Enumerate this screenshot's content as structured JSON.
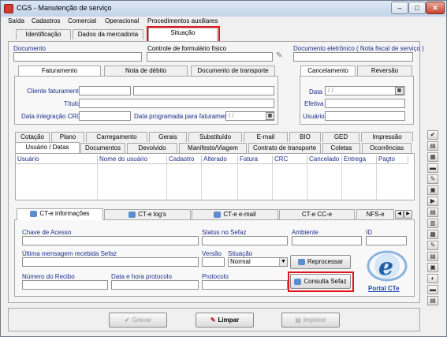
{
  "window": {
    "title": "CGS - Manutenção de serviço"
  },
  "menu": [
    "Saída",
    "Cadastros",
    "Comercial",
    "Operacional",
    "Procedimentos auxiliares"
  ],
  "top_tabs": [
    "Identificação",
    "Dados da mercadoria",
    "Situação"
  ],
  "documents": {
    "documento_label": "Documento",
    "controle_label": "Controle de formulário físico",
    "doc_eletronico_label": "Documento eletrônico ( Nota fiscal de serviço )"
  },
  "faturamento_tabs": [
    "Faturamento",
    "Nota de débito",
    "Documento de transporte"
  ],
  "faturamento": {
    "cliente_label": "Cliente faturamento",
    "titulo_label": "Título",
    "data_integracao_label": "Data integração CRC",
    "data_programada_label": "Data programada para faturamento",
    "data_programada_value": "/ /"
  },
  "cancel_tabs": [
    "Cancelamento",
    "Reversão"
  ],
  "cancelamento": {
    "data_label": "Data",
    "data_value": "/ /",
    "efetiva_label": "Efetiva",
    "usuario_label": "Usuário"
  },
  "tabs_row1": [
    "Cotação",
    "Plano",
    "Carregamento",
    "Gerais",
    "Substituído",
    "E-mail",
    "BIO",
    "GED",
    "Impressão"
  ],
  "tabs_row2": [
    "Usuário / Datas",
    "Documentos",
    "Devolvido",
    "Manifesto/Viagem",
    "Contrato de transporte",
    "Coletas",
    "Ocorrências"
  ],
  "grid_columns": [
    "Usuário",
    "Nome do usuário",
    "Cadastro",
    "Alterado",
    "Fatura",
    "CRC",
    "Cancelado",
    "Entrega",
    "Pagto"
  ],
  "cte_tabs": [
    "CT-e informações",
    "CT-e log's",
    "CT-e e-mail",
    "CT-e CC-e",
    "NFS-e"
  ],
  "cte": {
    "chave_label": "Chave de Acesso",
    "status_label": "Status no Sefaz",
    "ambiente_label": "Ambiente",
    "id_label": "ID",
    "ultima_msg_label": "Última mensagem recebida Sefaz",
    "versao_label": "Versão",
    "situacao_label": "Situação",
    "situacao_value": "Normal",
    "reprocessar_label": "Reprocessar",
    "recibo_label": "Número do Recibo",
    "data_hora_label": "Data e hora protocolo",
    "protocolo_label": "Protocolo",
    "consulta_label": "Consulta Sefaz",
    "portal_label": "Portal CTe"
  },
  "footer": {
    "gravar": "Gravar",
    "limpar": "Limpar",
    "imprimir": "Imprimir"
  },
  "colors": {
    "highlight": "#e1141b",
    "label_blue": "#1c2e8c"
  }
}
